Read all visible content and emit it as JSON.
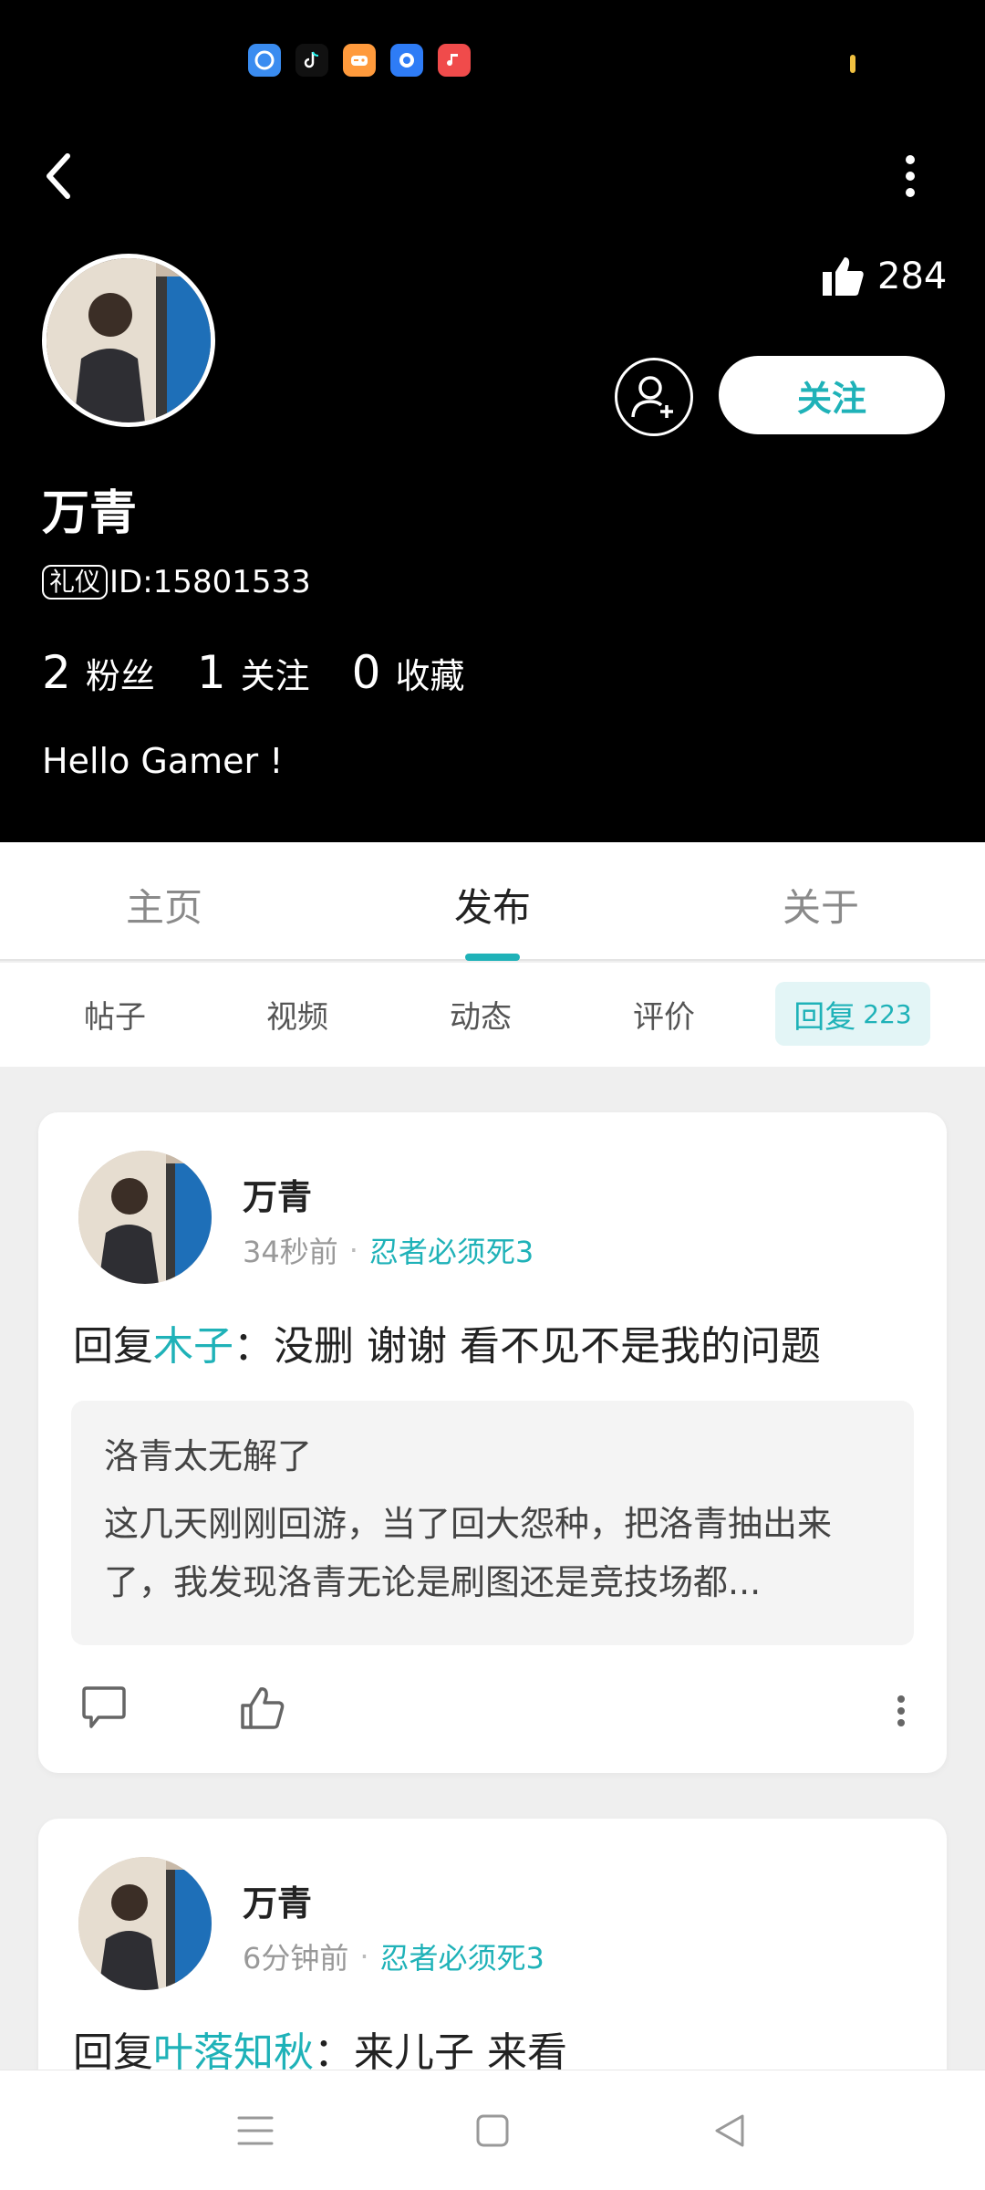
{
  "header": {
    "like_count": "284",
    "follow_label": "关注",
    "user_name": "万青",
    "id_badge": "礼仪",
    "id_text": "ID:15801533",
    "stats": [
      {
        "num": "2",
        "label": "粉丝"
      },
      {
        "num": "1",
        "label": "关注"
      },
      {
        "num": "0",
        "label": "收藏"
      }
    ],
    "bio": "Hello Gamer !"
  },
  "main_tabs": [
    "主页",
    "发布",
    "关于"
  ],
  "sub_tabs": [
    "帖子",
    "视频",
    "动态",
    "评价"
  ],
  "active_sub_tab": {
    "label": "回复",
    "count": "223"
  },
  "posts": [
    {
      "name": "万青",
      "time": "34秒前",
      "game": "忍者必须死3",
      "reply_prefix": "回复",
      "reply_to": "木子",
      "reply_text": "：没删 谢谢 看不见不是我的问题",
      "quote_title": "洛青太无解了",
      "quote_body": "这几天刚刚回游，当了回大怨种，把洛青抽出来了，我发现洛青无论是刷图还是竞技场都..."
    },
    {
      "name": "万青",
      "time": "6分钟前",
      "game": "忍者必须死3",
      "reply_prefix": "回复",
      "reply_to": "叶落知秋",
      "reply_text": "：来儿子 来看"
    }
  ],
  "colors": {
    "accent": "#1fb2b8",
    "header_bg": "#000000",
    "page_bg": "#efefef"
  }
}
